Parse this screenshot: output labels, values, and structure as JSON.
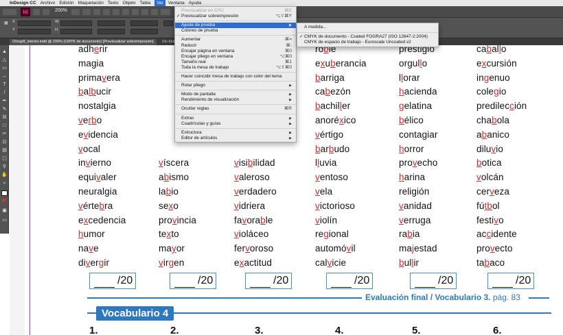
{
  "menubar": {
    "app": "InDesign CC",
    "items": [
      "Archivo",
      "Edición",
      "Maquetación",
      "Texto",
      "Objeto",
      "Tabla",
      "Ver",
      "Ventana",
      "Ayuda"
    ],
    "active": "Ver"
  },
  "appbar": {
    "logo": "Id",
    "zoom": "200%"
  },
  "tabs": [
    {
      "label": "Ortogr8_interior.indd @ 200% (CMYK de documento) [Previsualizar sobreimpresión]",
      "active": true
    },
    {
      "label": "Sin título",
      "active": false
    }
  ],
  "view_menu": {
    "items": [
      {
        "label": "Previsualizar en CPU",
        "shortcut": "⌘E",
        "disabled": true
      },
      {
        "label": "Previsualizar sobreimpresión",
        "shortcut": "⌥⇧⌘Y",
        "checked": true
      },
      {
        "sep": true
      },
      {
        "label": "Ajuste de prueba",
        "submenu": true,
        "highlighted": true
      },
      {
        "label": "Colores de prueba"
      },
      {
        "sep": true
      },
      {
        "label": "Aumentar",
        "shortcut": "⌘="
      },
      {
        "label": "Reducir",
        "shortcut": "⌘-"
      },
      {
        "label": "Encajar página en ventana",
        "shortcut": "⌘0"
      },
      {
        "label": "Encajar pliego en ventana",
        "shortcut": "⌥⌘0"
      },
      {
        "label": "Tamaño real",
        "shortcut": "⌘1"
      },
      {
        "label": "Toda la mesa de trabajo",
        "shortcut": "⌥⇧⌘0"
      },
      {
        "sep": true
      },
      {
        "label": "Hacer coincidir mesa de trabajo con color del tema"
      },
      {
        "sep": true
      },
      {
        "label": "Rotar pliego",
        "submenu": true
      },
      {
        "sep": true
      },
      {
        "label": "Modo de pantalla",
        "submenu": true
      },
      {
        "label": "Rendimiento de visualización",
        "submenu": true
      },
      {
        "sep": true
      },
      {
        "label": "Ocultar reglas",
        "shortcut": "⌘R"
      },
      {
        "sep": true
      },
      {
        "label": "Extras",
        "submenu": true
      },
      {
        "label": "Cuadrículas y guías",
        "submenu": true
      },
      {
        "sep": true
      },
      {
        "label": "Estructura",
        "submenu": true
      },
      {
        "label": "Editor de artículos",
        "submenu": true
      }
    ]
  },
  "proof_submenu": {
    "items": [
      {
        "label": "A medida..."
      },
      {
        "sep": true
      },
      {
        "label": "CMYK de documento - Coated FOGRA27 (ISO 12647-2:2004)",
        "checked": true
      },
      {
        "label": "CMYK de espacio de trabajo - Euroscale Uncoated v2"
      }
    ]
  },
  "worksheet": {
    "columns": [
      [
        "adhe_rir",
        "magia",
        "primav_era",
        "b_al_b_ucir",
        "nostalgia",
        "v_er_b_o",
        "ev_idencia",
        "v_ocal",
        "inv_ierno",
        "equiv_aler",
        "neuralgia",
        "v_érteb_ra",
        "ex_cedencia",
        "h_umor",
        "nav_e",
        "div_erg_ir"
      ],
      [
        "",
        "",
        "",
        "",
        "",
        "",
        "",
        "",
        "v_íscera",
        "ab_ismo",
        "lab_io",
        "sex_o",
        "prov_incia",
        "tex_to",
        "may_or",
        "v_irg_en"
      ],
      [
        "",
        "",
        "",
        "",
        "",
        "",
        "",
        "",
        "v_isib_ilidad",
        "v_aleroso",
        "v_erdadero",
        "v_idriera",
        "fav_orab_le",
        "v_ioláceo",
        "ferv_oroso",
        "ex_actitud"
      ],
      [
        "rob_le",
        "ex_ub_erancia",
        "b_arriga",
        "cab_ezón",
        "b_achill_er",
        "anoréx_ico",
        "v_értigo",
        "b_arb_udo",
        "ll_uvia",
        "v_entoso",
        "v_ela",
        "v_ictorioso",
        "v_iolín",
        "reg_ional",
        "automóv_il",
        "calv_icie"
      ],
      [
        "prestigio",
        "orgull_o",
        "ll_orar",
        "h_acienda",
        "g_elatina",
        "b_élico",
        "contagiar",
        "h_orror",
        "prov_echo",
        "h_arina",
        "religión",
        "v_anidad",
        "v_erruga",
        "rab_ia",
        "maj_estad",
        "b_ull_ir"
      ],
      [
        "cab_all_o",
        "ex_cursión",
        "ing_enuo",
        "coleg_io",
        "predilecc_ión",
        "chab_ola",
        "ab_anico",
        "diluv_io",
        "b_otica",
        "v_olcán",
        "cerv_eza",
        "fút_b_ol",
        "festiv_o",
        "acc_idente",
        "prov_ecto",
        "tab_aco"
      ]
    ],
    "score_label": "/20",
    "footer": {
      "text": "Evaluación final / Vocabulario 3.",
      "page": "pág. 83"
    },
    "section_title": "Vocabulario 4",
    "numbers": [
      "1.",
      "2.",
      "3.",
      "4.",
      "5.",
      "6."
    ]
  },
  "colors": {
    "accent_blue": "#2c79c2",
    "mark_red": "#d42a2a",
    "menu_highlight": "#2d6bd6"
  }
}
